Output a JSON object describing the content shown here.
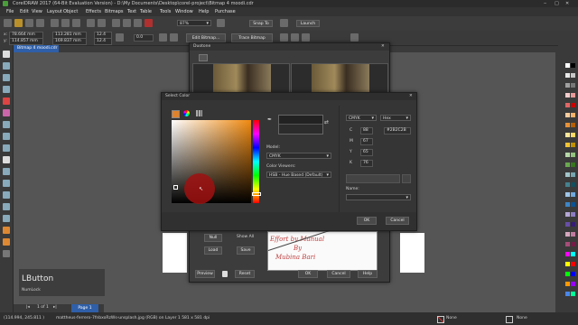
{
  "window": {
    "title": "CorelDRAW 2017 (64-Bit Evaluation Version) - D:\\My Documents\\Desktop\\corel-project\\Bitmap 4 moodi.cdr"
  },
  "menu": [
    "File",
    "Edit",
    "View",
    "Layout",
    "Object",
    "Effects",
    "Bitmaps",
    "Text",
    "Table",
    "Tools",
    "Window",
    "Help",
    "Purchase"
  ],
  "toolbar": {
    "zoom": "87%",
    "snap_to": "Snap To",
    "launch": "Launch"
  },
  "propbar": {
    "x": "78.664 mm",
    "y": "114.857 mm",
    "w": "113.281 mm",
    "h": "169.837 mm",
    "sx": "12.4",
    "sy": "12.4",
    "angle": "0.0",
    "edit_bitmap": "Edit Bitmap...",
    "trace_bitmap": "Trace Bitmap"
  },
  "doc_tab": "Bitmap 4 moodi.cdr",
  "duotone": {
    "title": "Duotone",
    "null": "Null",
    "show_all": "Show All",
    "load": "Load",
    "save": "Save",
    "preview": "Preview",
    "reset": "Reset",
    "ok": "OK",
    "cancel": "Cancel",
    "help": "Help",
    "watermark1": "Effort by Manual",
    "watermark2": "By",
    "watermark3": "Mubina Bari"
  },
  "select_color": {
    "title": "Select Color",
    "model_label": "Model:",
    "model_value": "CMYK",
    "viewers_label": "Color Viewers:",
    "viewers_value": "HSB - Hue Based (Default)",
    "right_model": "CMYK",
    "right_hex_mode": "Hex",
    "c_label": "C",
    "c_value": "88",
    "m_label": "M",
    "m_value": "67",
    "y_label": "Y",
    "y_value": "65",
    "k_label": "K",
    "k_value": "76",
    "hex_value": "#2B2C2B",
    "name_label": "Name:",
    "ok": "OK",
    "cancel": "Cancel"
  },
  "status": {
    "coords": "(114.994, 245.811 )",
    "file_info": "mattheus-ferrero-7fnbxoRzWs-unsplash.jpg (RGB) on Layer 1 581 x 581 dpi",
    "fill": "None",
    "outline": "None",
    "page_count": "1 of 1",
    "page_tab": "Page 1"
  },
  "overlay": {
    "lbutton": "LButton",
    "numlock": "NumLock"
  },
  "colors": {
    "accent_blue": "#2f5fa8",
    "preview_color": "#2b2c2b",
    "cursor_red": "#a01010"
  }
}
